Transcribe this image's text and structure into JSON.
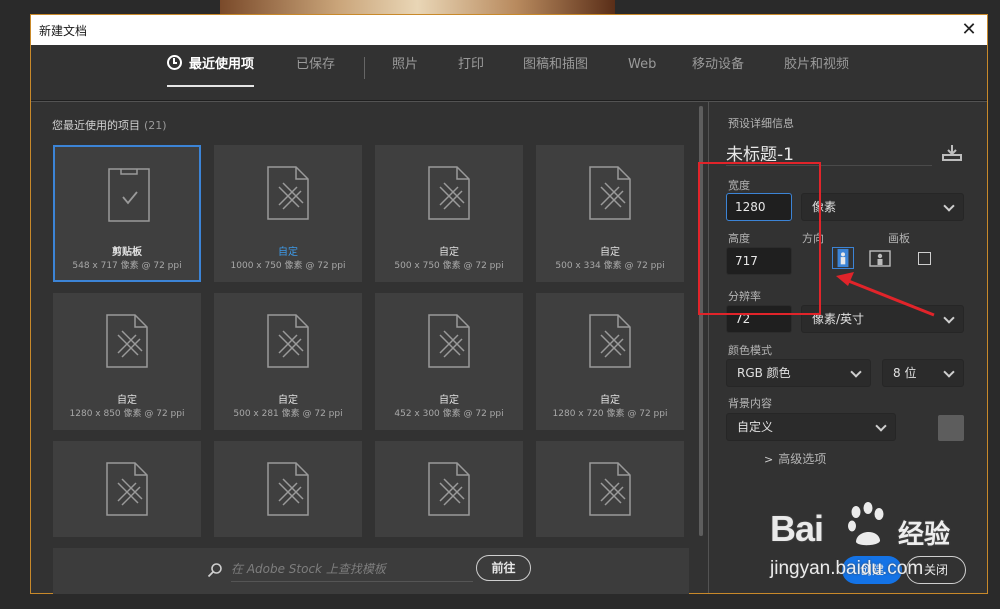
{
  "window": {
    "title": "新建文档",
    "close_glyph": "✕"
  },
  "tabs": [
    {
      "label": "最近使用项",
      "active": true
    },
    {
      "label": "已保存"
    },
    {
      "label": "照片"
    },
    {
      "label": "打印"
    },
    {
      "label": "图稿和插图"
    },
    {
      "label": "Web"
    },
    {
      "label": "移动设备"
    },
    {
      "label": "胶片和视频"
    }
  ],
  "recent": {
    "label": "您最近使用的项目",
    "count": "(21)",
    "items": [
      {
        "name": "剪贴板",
        "meta": "548 x 717 像素 @ 72 ppi",
        "selected": true,
        "icon": "clipboard-doc-icon"
      },
      {
        "name": "自定",
        "meta": "1000 x 750 像素 @ 72 ppi",
        "highlight": true,
        "icon": "pencil-ruler-doc-icon"
      },
      {
        "name": "自定",
        "meta": "500 x 750 像素 @ 72 ppi",
        "icon": "pencil-ruler-doc-icon"
      },
      {
        "name": "自定",
        "meta": "500 x 334 像素 @ 72 ppi",
        "icon": "pencil-ruler-doc-icon"
      },
      {
        "name": "自定",
        "meta": "1280 x 850 像素 @ 72 ppi",
        "icon": "pencil-ruler-doc-icon"
      },
      {
        "name": "自定",
        "meta": "500 x 281 像素 @ 72 ppi",
        "icon": "pencil-ruler-doc-icon"
      },
      {
        "name": "自定",
        "meta": "452 x 300 像素 @ 72 ppi",
        "icon": "pencil-ruler-doc-icon"
      },
      {
        "name": "自定",
        "meta": "1280 x 720 像素 @ 72 ppi",
        "icon": "pencil-ruler-doc-icon"
      },
      {
        "name": "",
        "meta": "",
        "icon": "pencil-ruler-doc-icon"
      },
      {
        "name": "",
        "meta": "",
        "icon": "pencil-ruler-doc-icon"
      },
      {
        "name": "",
        "meta": "",
        "icon": "pencil-ruler-doc-icon"
      },
      {
        "name": "",
        "meta": "",
        "icon": "pencil-ruler-doc-icon"
      }
    ]
  },
  "stock": {
    "placeholder": "在 Adobe Stock 上查找模板",
    "go_label": "前往"
  },
  "details": {
    "header": "预设详细信息",
    "doc_name": "未标题-1",
    "width_label": "宽度",
    "width_value": "1280",
    "width_unit": "像素",
    "height_label": "高度",
    "height_value": "717",
    "orientation_label": "方向",
    "artboard_label": "画板",
    "resolution_label": "分辨率",
    "resolution_value": "72",
    "resolution_unit": "像素/英寸",
    "color_mode_label": "颜色模式",
    "color_mode": "RGB 颜色",
    "bit_depth": "8 位",
    "background_label": "背景内容",
    "background": "自定义",
    "background_color": "#5d5d5d",
    "advanced_label": "高级选项",
    "create_label": "创建",
    "close_label": "关闭"
  },
  "watermark": {
    "logo_text": "Bai",
    "cn_text": "经验",
    "url": "jingyan.baidu.com"
  },
  "colors": {
    "accent": "#1473e6",
    "selection": "#3c84d6",
    "annotation": "#e1242a",
    "dialog_border": "#c8892a"
  }
}
